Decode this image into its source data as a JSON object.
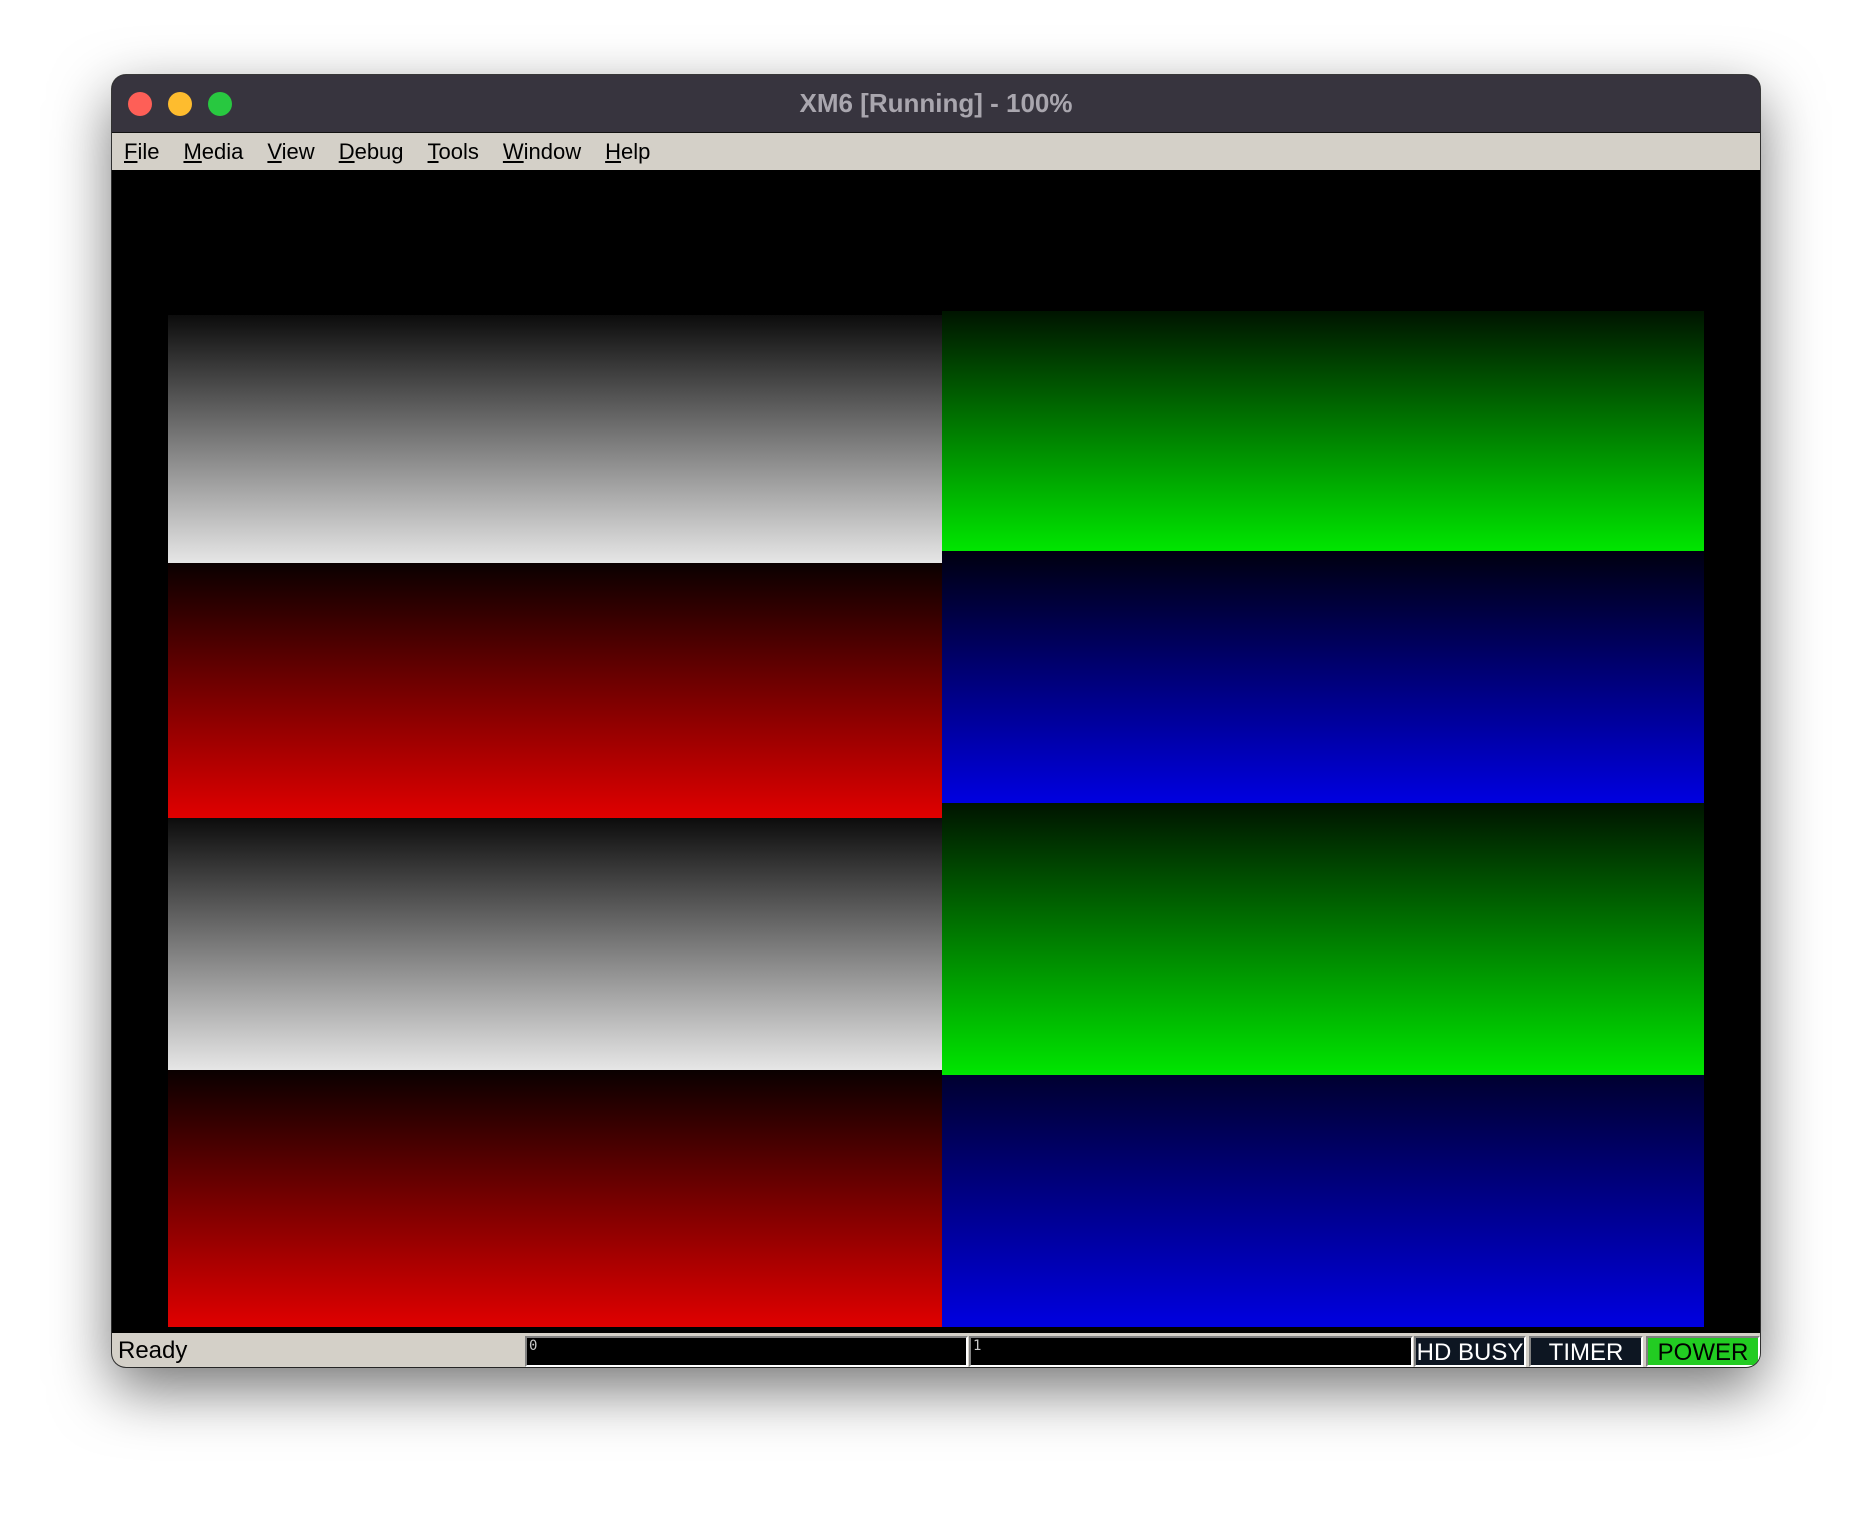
{
  "window": {
    "title": "XM6 [Running] - 100%"
  },
  "menubar": {
    "items": [
      {
        "label": "File",
        "mnemonic": "F",
        "rest": "ile"
      },
      {
        "label": "Media",
        "mnemonic": "M",
        "rest": "edia"
      },
      {
        "label": "View",
        "mnemonic": "V",
        "rest": "iew"
      },
      {
        "label": "Debug",
        "mnemonic": "D",
        "rest": "ebug"
      },
      {
        "label": "Tools",
        "mnemonic": "T",
        "rest": "ools"
      },
      {
        "label": "Window",
        "mnemonic": "W",
        "rest": "indow"
      },
      {
        "label": "Help",
        "mnemonic": "H",
        "rest": "elp"
      }
    ]
  },
  "screen": {
    "description": "Color gradient test pattern (8 bands: gray, green, red, blue repeated)",
    "panels": [
      {
        "name": "gray-gradient-1",
        "color_from": "#0c0c0c",
        "color_to": "#e6e6e6"
      },
      {
        "name": "green-gradient-1",
        "color_from": "#001400",
        "color_to": "#00e600"
      },
      {
        "name": "red-gradient-1",
        "color_from": "#0a0000",
        "color_to": "#e00000"
      },
      {
        "name": "blue-gradient-1",
        "color_from": "#000010",
        "color_to": "#0000e0"
      },
      {
        "name": "gray-gradient-2",
        "color_from": "#0c0c0c",
        "color_to": "#e6e6e6"
      },
      {
        "name": "green-gradient-2",
        "color_from": "#001400",
        "color_to": "#00e600"
      },
      {
        "name": "red-gradient-2",
        "color_from": "#0a0000",
        "color_to": "#e00000"
      },
      {
        "name": "blue-gradient-2",
        "color_from": "#000030",
        "color_to": "#0000e0"
      }
    ]
  },
  "statusbar": {
    "message": "Ready",
    "drive0": "0",
    "drive1": "1",
    "indicators": [
      {
        "label": "HD BUSY",
        "active": false,
        "bg": "#0d1622",
        "fg": "#ffffff"
      },
      {
        "label": "TIMER",
        "active": false,
        "bg": "#0d1622",
        "fg": "#ffffff"
      },
      {
        "label": "POWER",
        "active": true,
        "bg": "#22cc22",
        "fg": "#000000"
      }
    ]
  }
}
